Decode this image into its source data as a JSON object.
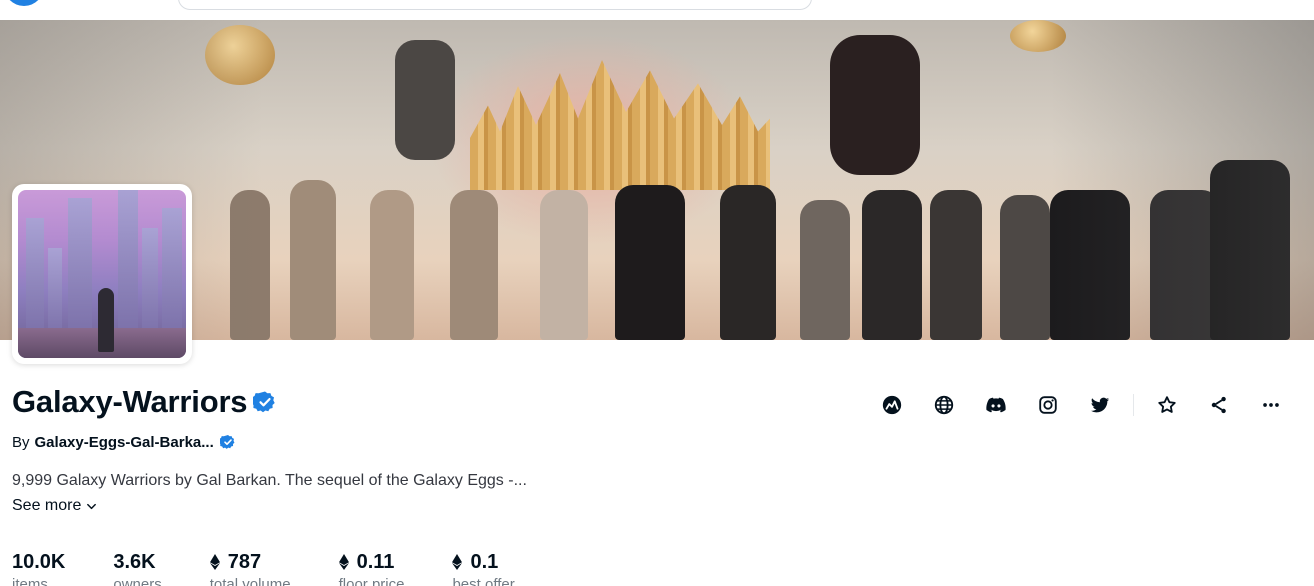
{
  "header": {
    "logo_icon": "opensea-logo-icon",
    "search_icon": "search-field"
  },
  "banner": {
    "image_icon": "banner-image"
  },
  "collection": {
    "avatar_icon": "collection-avatar-image",
    "name": "Galaxy-Warriors",
    "verified_icon": "verified-badge-icon",
    "creator_prefix": "By",
    "creator_name": "Galaxy-Eggs-Gal-Barka...",
    "description": "9,999 Galaxy Warriors by Gal Barkan. The sequel of the Galaxy Eggs -...",
    "see_more_label": "See more"
  },
  "stats": [
    {
      "value": "10.0K",
      "label": "items",
      "eth": false
    },
    {
      "value": "3.6K",
      "label": "owners",
      "eth": false
    },
    {
      "value": "787",
      "label": "total volume",
      "eth": true
    },
    {
      "value": "0.11",
      "label": "floor price",
      "eth": true
    },
    {
      "value": "0.1",
      "label": "best offer",
      "eth": true
    }
  ],
  "actions": [
    {
      "icon": "activity-chart-icon"
    },
    {
      "icon": "globe-icon"
    },
    {
      "icon": "discord-icon"
    },
    {
      "icon": "instagram-icon"
    },
    {
      "icon": "twitter-icon"
    },
    {
      "icon": "star-icon"
    },
    {
      "icon": "share-icon"
    },
    {
      "icon": "more-options-icon"
    }
  ],
  "colors": {
    "accent": "#2081e2",
    "text": "#04111d",
    "muted": "#707a83"
  }
}
